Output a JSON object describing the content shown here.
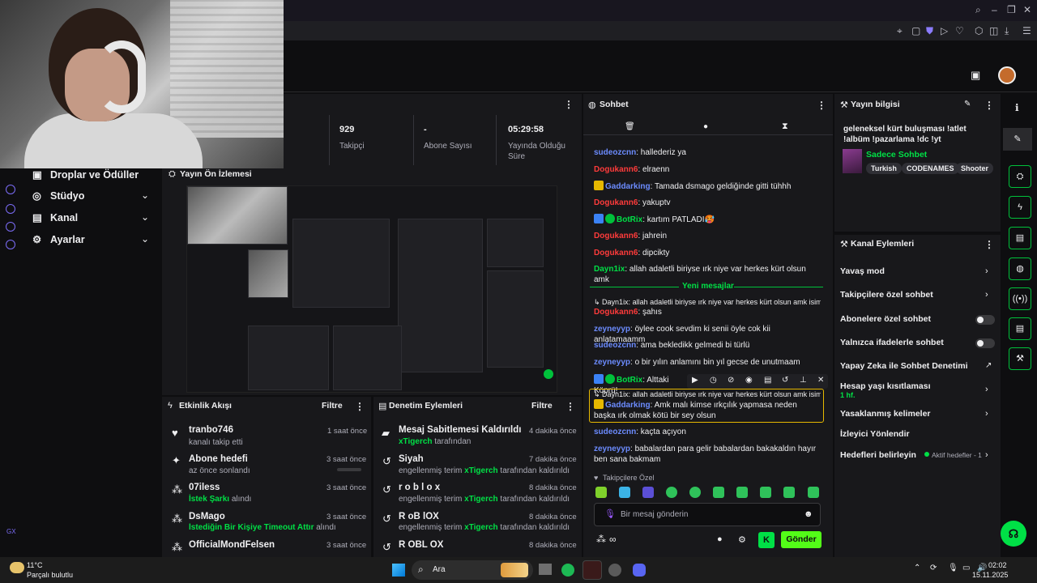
{
  "stats": [
    {
      "value": "929",
      "label": "Takipçi"
    },
    {
      "value": "-",
      "label": "Abone Sayısı"
    },
    {
      "value": "05:29:58",
      "label": "Yayında Olduğu Süre"
    }
  ],
  "nav": {
    "items": [
      "Droplar ve Ödüller",
      "Stüdyo",
      "Kanal",
      "Ayarlar"
    ]
  },
  "preview": {
    "title": "Yayın Ön İzlemesi"
  },
  "activity": {
    "title": "Etkinlik Akışı",
    "filter": "Filtre",
    "rows": [
      {
        "title": "tranbo746",
        "sub": "kanalı takip etti",
        "time": "1 saat önce"
      },
      {
        "title": "Abone hedefi",
        "sub": "az önce sonlandı",
        "time": "3 saat önce"
      },
      {
        "title": "07iless",
        "sub_hl": "İstek Şarkı",
        "sub": " alındı",
        "time": "3 saat önce"
      },
      {
        "title": "DsMago",
        "sub_hl": "İstediğin Bir Kişiye Timeout Attır",
        "sub": " alındı",
        "time": "3 saat önce"
      },
      {
        "title": "OfficialMondFelsen",
        "time": "3 saat önce"
      }
    ]
  },
  "moderation": {
    "title": "Denetim Eylemleri",
    "filter": "Filtre",
    "rows": [
      {
        "title": "Mesaj Sabitlemesi Kaldırıldı",
        "by": "xTigerch",
        "sub": " tarafından",
        "time": "4 dakika önce"
      },
      {
        "title": "Siyah",
        "pre": "engellenmiş terim ",
        "by": "xTigerch",
        "sub": " tarafından kaldırıldı",
        "time": "7 dakika önce"
      },
      {
        "title": "r o b l o x",
        "pre": "engellenmiş terim ",
        "by": "xTigerch",
        "sub": " tarafından kaldırıldı",
        "time": "8 dakika önce"
      },
      {
        "title": "R oB lOX",
        "pre": "engellenmiş terim ",
        "by": "xTigerch",
        "sub": " tarafından kaldırıldı",
        "time": "8 dakika önce"
      },
      {
        "title": "R OBL OX",
        "time": "8 dakika önce"
      }
    ]
  },
  "chat": {
    "title": "Sohbet",
    "new_messages": "Yeni mesajlar",
    "messages": [
      {
        "user": "sudeozcnn",
        "color": "#6c8cff",
        "text": ": hallederiz ya"
      },
      {
        "user": "Dogukann6",
        "color": "#ff3b3b",
        "text": ": elraenn"
      },
      {
        "user": "Gaddarking",
        "color": "#6c8cff",
        "text": ": Tamada dsmago geldiğinde gitti tühhh"
      },
      {
        "user": "Dogukann6",
        "color": "#ff3b3b",
        "text": ": yakuptv"
      },
      {
        "user": "BotRix",
        "color": "#00e046",
        "text": ": kartım PATLADI🥵"
      },
      {
        "user": "Dogukann6",
        "color": "#ff3b3b",
        "text": ": jahrein"
      },
      {
        "user": "Dogukann6",
        "color": "#ff3b3b",
        "text": ": dipcikty"
      },
      {
        "user": "Dayn1ix",
        "color": "#00e046",
        "text": ": allah adaletli biriyse ırk niye var herkes kürt olsun amk"
      },
      {
        "reply": "Dayn1ix: allah adaletli biriyse ırk niye var herkes kürt olsun amk isimi..."
      },
      {
        "user": "Dogukann6",
        "color": "#ff3b3b",
        "text": ": şahıs"
      },
      {
        "user": "zeyneyyp",
        "color": "#6c8cff",
        "text": ": öylee cook sevdim ki senii öyle cok kii anlatamaamm"
      },
      {
        "user": "sudeozcnn",
        "color": "#6c8cff",
        "text": ": ama bekledikk gelmedi bi türlü"
      },
      {
        "user": "zeyneyyp",
        "color": "#6c8cff",
        "text": ": o bir yılın anlamını bin yıl gecse de unutmaam"
      },
      {
        "user": "BotRix",
        "color": "#00e046",
        "text": ": Alttaki Köprü!"
      },
      {
        "reply": "Dayn1ix: allah adaletli biriyse ırk niye var herkes kürt olsun amk isimi..."
      },
      {
        "user": "Gaddarking",
        "color": "#6c8cff",
        "text": ": Amk malı kimse ırkçılık yapmasa neden başka ırk olmak kötü bir sey olsun"
      },
      {
        "user": "sudeozcnn",
        "color": "#6c8cff",
        "text": ": kaçta açıyon"
      },
      {
        "user": "zeyneyyp",
        "color": "#6c8cff",
        "text": ": babalardan para gelir babalardan bakakaldın hayır ben sana bakmam"
      }
    ],
    "followers_only": "Takipçilere Özel",
    "input_placeholder": "Bir mesaj gönderin",
    "send": "Gönder"
  },
  "info": {
    "title": "Yayın bilgisi",
    "stream_title": "geleneksel kürt buluşması !atlet !albüm !pazarlama !dc !yt",
    "category": "Sadece Sohbet",
    "tags": [
      "Turkish",
      "CODENAMES",
      "Shooter"
    ]
  },
  "actions": {
    "title": "Kanal Eylemleri",
    "items": [
      "Yavaş mod",
      "Takipçilere özel sohbet",
      "Abonelere özel sohbet",
      "Yalnızca ifadelerle sohbet",
      "Yapay Zeka ile Sohbet Denetimi",
      "Hesap yaşı kısıtlaması",
      "Yasaklanmış kelimeler",
      "İzleyici Yönlendir",
      "Hedefleri belirleyin"
    ],
    "age_value": "1 hf.",
    "goals_status": "Aktif hedefler - 1"
  },
  "taskbar": {
    "temp": "11°C",
    "weather": "Parçalı bulutlu",
    "search": "Ara",
    "time": "02:02",
    "date": "15.11.2025"
  },
  "leftrail": {
    "label": "GX"
  }
}
